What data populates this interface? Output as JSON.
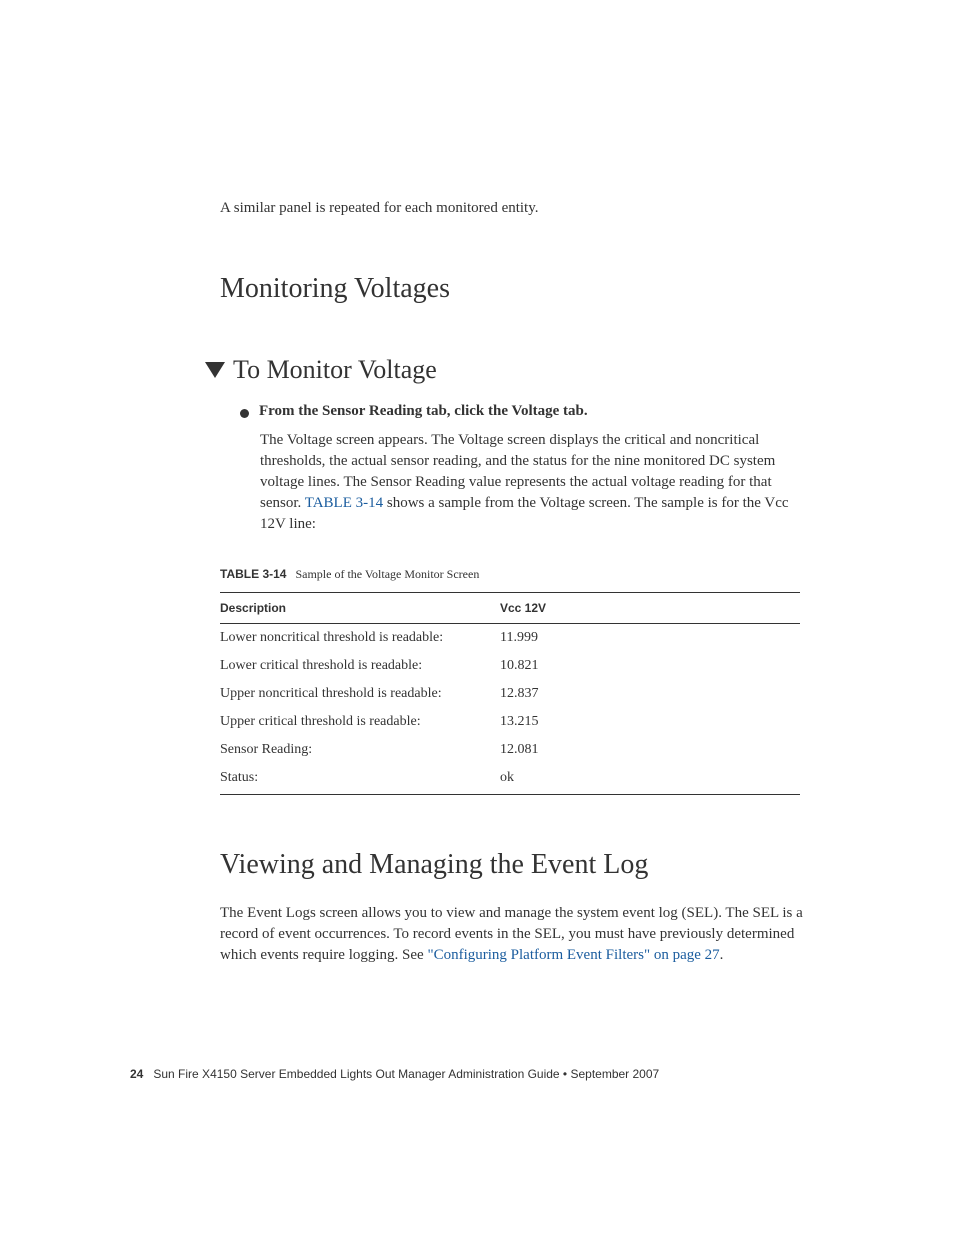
{
  "intro": "A similar panel is repeated for each monitored entity.",
  "section1": {
    "title": "Monitoring Voltages"
  },
  "section2": {
    "title": "To Monitor Voltage",
    "bullet": "From the Sensor Reading tab, click the Voltage tab.",
    "para_before_link": "The Voltage screen appears. The Voltage screen displays the critical and noncritical thresholds, the actual sensor reading, and the status for the nine monitored DC system voltage lines. The Sensor Reading value represents the actual voltage reading for that sensor. ",
    "link_text": "TABLE 3-14",
    "para_after_link": " shows a sample from the Voltage screen. The sample is for the Vcc 12V line:"
  },
  "table": {
    "caption_label": "TABLE 3-14",
    "caption_text": "Sample of the Voltage Monitor Screen",
    "headers": {
      "col1": "Description",
      "col2": "Vcc 12V"
    },
    "rows": [
      {
        "desc": "Lower noncritical threshold is readable:",
        "val": "11.999"
      },
      {
        "desc": "Lower critical threshold is readable:",
        "val": "10.821"
      },
      {
        "desc": "Upper noncritical threshold is readable:",
        "val": "12.837"
      },
      {
        "desc": "Upper critical threshold is readable:",
        "val": "13.215"
      },
      {
        "desc": "Sensor Reading:",
        "val": "12.081"
      },
      {
        "desc": "Status:",
        "val": "ok"
      }
    ]
  },
  "chart_data": {
    "type": "table",
    "title": "Sample of the Voltage Monitor Screen",
    "columns": [
      "Description",
      "Vcc 12V"
    ],
    "rows": [
      [
        "Lower noncritical threshold is readable:",
        "11.999"
      ],
      [
        "Lower critical threshold is readable:",
        "10.821"
      ],
      [
        "Upper noncritical threshold is readable:",
        "12.837"
      ],
      [
        "Upper critical threshold is readable:",
        "13.215"
      ],
      [
        "Sensor Reading:",
        "12.081"
      ],
      [
        "Status:",
        "ok"
      ]
    ]
  },
  "section3": {
    "title": "Viewing and Managing the Event Log",
    "para_before_link": "The Event Logs screen allows you to view and manage the system event log (SEL). The SEL is a record of event occurrences. To record events in the SEL, you must have previously determined which events require logging. See ",
    "link_text": "\"Configuring Platform Event Filters\" on page 27",
    "para_after_link": "."
  },
  "footer": {
    "page_num": "24",
    "text": "Sun Fire X4150 Server Embedded Lights Out Manager Administration Guide • September 2007"
  }
}
